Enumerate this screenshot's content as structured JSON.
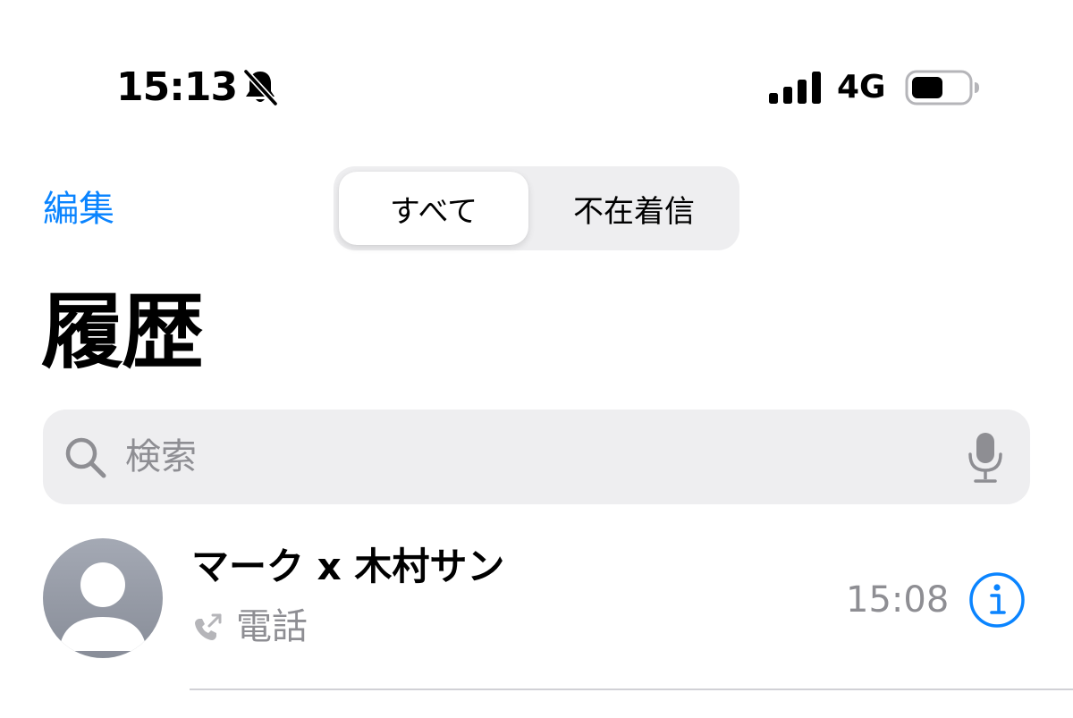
{
  "status_bar": {
    "time": "15:13",
    "network": "4G",
    "icons": [
      "bell-slash-icon",
      "signal-icon",
      "battery-icon"
    ]
  },
  "nav": {
    "edit_label": "編集",
    "segments": [
      {
        "label": "すべて",
        "selected": true
      },
      {
        "label": "不在着信",
        "selected": false
      }
    ]
  },
  "page": {
    "title": "履歴"
  },
  "search": {
    "placeholder": "検索",
    "value": "",
    "icons": [
      "magnifier-icon",
      "microphone-icon"
    ]
  },
  "calls": [
    {
      "name": "マーク x 木村サン",
      "type": "電話",
      "time": "15:08",
      "direction_icon": "outgoing-call-icon"
    }
  ],
  "colors": {
    "accent": "#0a84ff",
    "secondary_text": "#8e8e93",
    "fill": "#eeeef0",
    "separator": "#d1d1d6"
  }
}
